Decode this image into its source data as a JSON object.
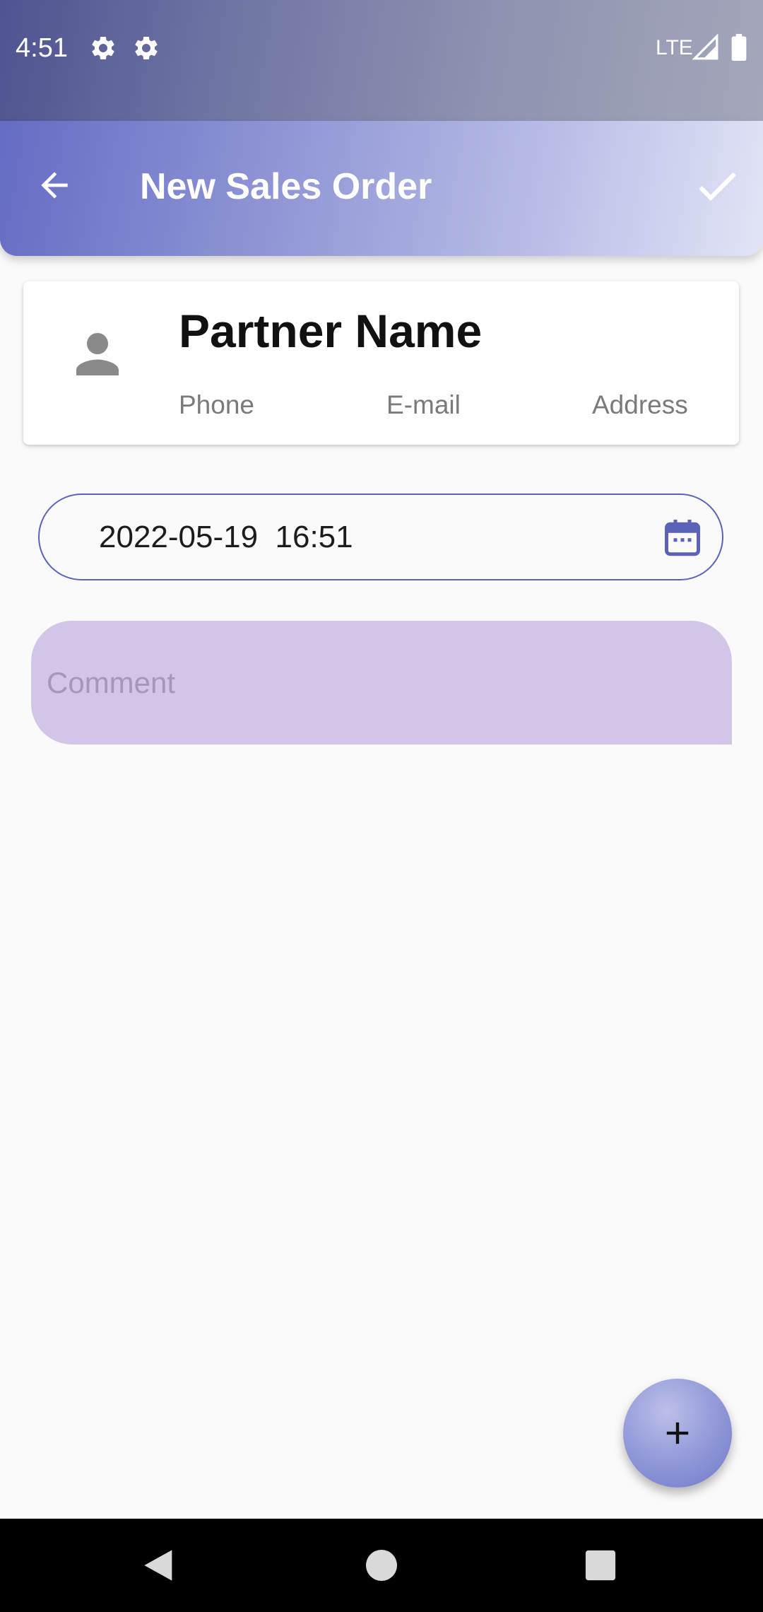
{
  "status_bar": {
    "time": "4:51",
    "network": "LTE",
    "icons": [
      "settings-gear-icon",
      "settings-gear-icon",
      "signal-icon",
      "battery-icon"
    ]
  },
  "app_bar": {
    "title": "New Sales Order",
    "back_icon": "arrow-back-icon",
    "confirm_icon": "check-icon"
  },
  "partner": {
    "name": "Partner Name",
    "phone": "Phone",
    "email": "E-mail",
    "address": "Address",
    "avatar_icon": "person-icon"
  },
  "order": {
    "datetime": "2022-05-19  16:51",
    "calendar_icon": "calendar-icon"
  },
  "comment": {
    "placeholder": "Comment",
    "value": ""
  },
  "fab": {
    "icon": "plus-icon"
  },
  "nav": {
    "icons": [
      "back-triangle-icon",
      "home-circle-icon",
      "recents-square-icon"
    ]
  },
  "colors": {
    "primary": "#5a63b8",
    "comment_bg": "#d3c5e8",
    "background": "#fafafa"
  }
}
